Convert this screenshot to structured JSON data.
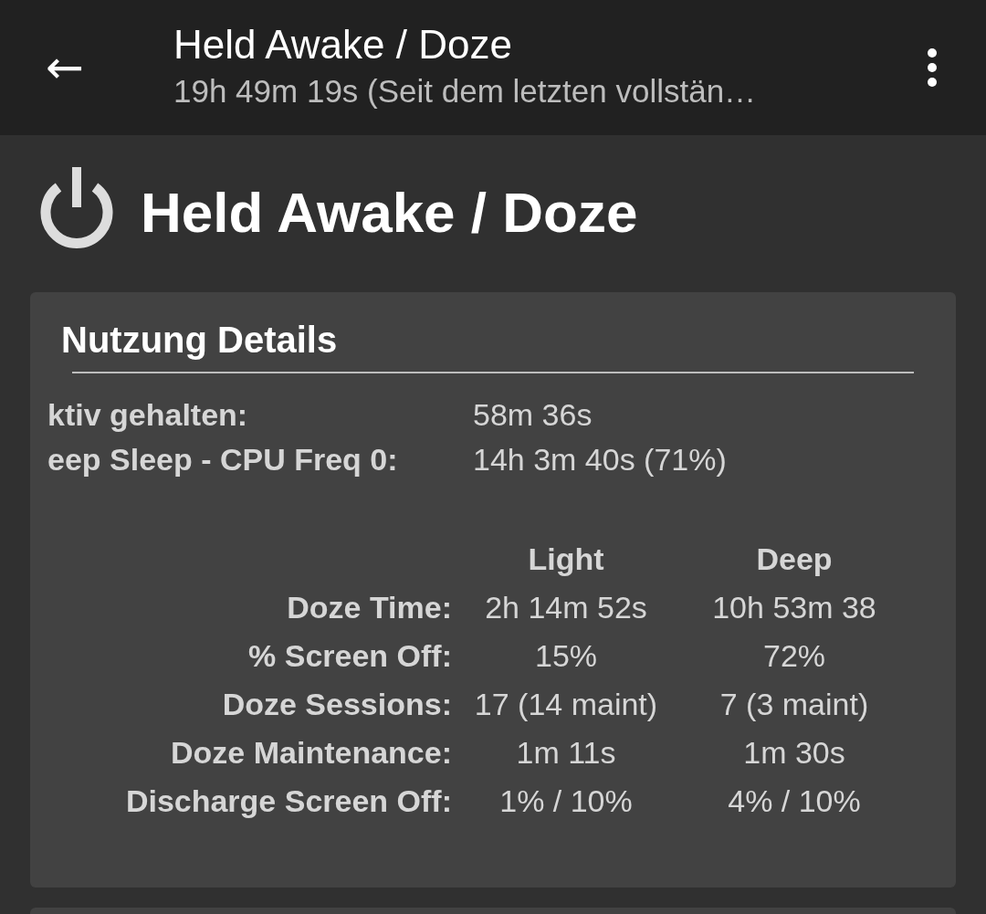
{
  "toolbar": {
    "back": "←",
    "title": "Held Awake / Doze",
    "subtitle": "19h 49m 19s (Seit dem letzten vollstän…"
  },
  "header": {
    "title": "Held Awake / Doze"
  },
  "card": {
    "title": "Nutzung Details",
    "stats": [
      {
        "label": "ktiv gehalten:",
        "value": "58m 36s"
      },
      {
        "label": "eep Sleep - CPU Freq 0:",
        "value": "14h 3m 40s (71%)"
      }
    ],
    "columns": [
      "Light",
      "Deep"
    ],
    "rows": [
      {
        "label": "Doze Time:",
        "light": "2h 14m 52s",
        "deep": "10h 53m 38"
      },
      {
        "label": "% Screen Off:",
        "light": "15%",
        "deep": "72%"
      },
      {
        "label": "Doze Sessions:",
        "light": "17 (14 maint)",
        "deep": "7 (3 maint)"
      },
      {
        "label": "Doze Maintenance:",
        "light": "1m 11s",
        "deep": "1m 30s"
      },
      {
        "label": "Discharge Screen Off:",
        "light": "1% / 10%",
        "deep": "4% / 10%"
      }
    ]
  }
}
